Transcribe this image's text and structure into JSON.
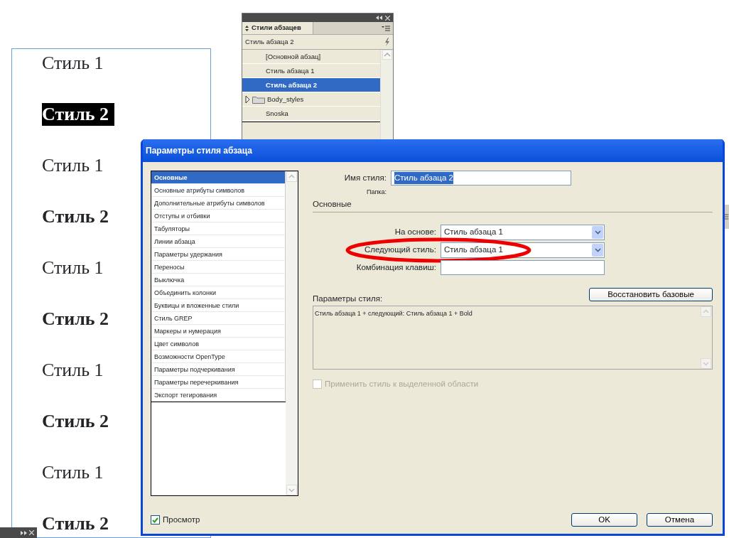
{
  "document": {
    "paragraphs": [
      {
        "text": "Стиль 1",
        "bold": false,
        "selected": false
      },
      {
        "text": "Стиль 2",
        "bold": true,
        "selected": true
      },
      {
        "text": "Стиль 1",
        "bold": false,
        "selected": false
      },
      {
        "text": "Стиль 2",
        "bold": true,
        "selected": false
      },
      {
        "text": "Стиль 1",
        "bold": false,
        "selected": false
      },
      {
        "text": "Стиль 2",
        "bold": true,
        "selected": false
      },
      {
        "text": "Стиль 1",
        "bold": false,
        "selected": false
      },
      {
        "text": "Стиль 2",
        "bold": true,
        "selected": false
      },
      {
        "text": "Стиль 1",
        "bold": false,
        "selected": false
      },
      {
        "text": "Стиль 2",
        "bold": true,
        "selected": false
      }
    ]
  },
  "styles_panel": {
    "tab": "Стили абзацев",
    "current": "Стиль абзаца 2",
    "items": [
      {
        "label": "[Основной абзац]",
        "kind": "style",
        "selected": false
      },
      {
        "label": "Стиль абзаца 1",
        "kind": "style",
        "selected": false
      },
      {
        "label": "Стиль абзаца 2",
        "kind": "style",
        "selected": true
      },
      {
        "label": "Body_styles",
        "kind": "folder",
        "expanded": false,
        "selected": false
      },
      {
        "label": "Snoska",
        "kind": "style",
        "selected": false
      }
    ]
  },
  "dialog": {
    "title": "Параметры стиля абзаца",
    "categories": [
      {
        "label": "Основные",
        "selected": true
      },
      {
        "label": "Основные атрибуты символов",
        "selected": false
      },
      {
        "label": "Дополнительные атрибуты символов",
        "selected": false
      },
      {
        "label": "Отступы и отбивки",
        "selected": false
      },
      {
        "label": "Табуляторы",
        "selected": false
      },
      {
        "label": "Линии абзаца",
        "selected": false
      },
      {
        "label": "Параметры удержания",
        "selected": false
      },
      {
        "label": "Переносы",
        "selected": false
      },
      {
        "label": "Выключка",
        "selected": false
      },
      {
        "label": "Объединить колонки",
        "selected": false
      },
      {
        "label": "Буквицы и вложенные стили",
        "selected": false
      },
      {
        "label": "Стиль GREP",
        "selected": false
      },
      {
        "label": "Маркеры и нумерация",
        "selected": false
      },
      {
        "label": "Цвет символов",
        "selected": false
      },
      {
        "label": "Возможности OpenType",
        "selected": false
      },
      {
        "label": "Параметры подчеркивания",
        "selected": false
      },
      {
        "label": "Параметры перечеркивания",
        "selected": false
      },
      {
        "label": "Экспорт тегирования",
        "selected": false
      }
    ],
    "style_name_label": "Имя стиля:",
    "style_name": "Стиль абзаца 2",
    "folder_label": "Папка:",
    "section": "Основные",
    "fields": [
      {
        "label": "На основе:",
        "kind": "dropdown",
        "value": "Стиль абзаца 1"
      },
      {
        "label": "Следующий стиль:",
        "kind": "dropdown",
        "value": "Стиль абзаца 1",
        "highlighted": true
      },
      {
        "label": "Комбинация клавиш:",
        "kind": "text"
      }
    ],
    "style_settings_label": "Параметры стиля:",
    "reset_button": "Восстановить базовые",
    "style_settings": "Стиль абзаца 1 + следующий: Стиль абзаца 1 + Bold",
    "apply_checkbox": {
      "label": "Применить стиль к выделенной области",
      "checked": false,
      "disabled": true
    },
    "preview_checkbox": {
      "label": "Просмотр",
      "checked": true,
      "disabled": false
    },
    "buttons": [
      "OK",
      "Отмена"
    ]
  }
}
